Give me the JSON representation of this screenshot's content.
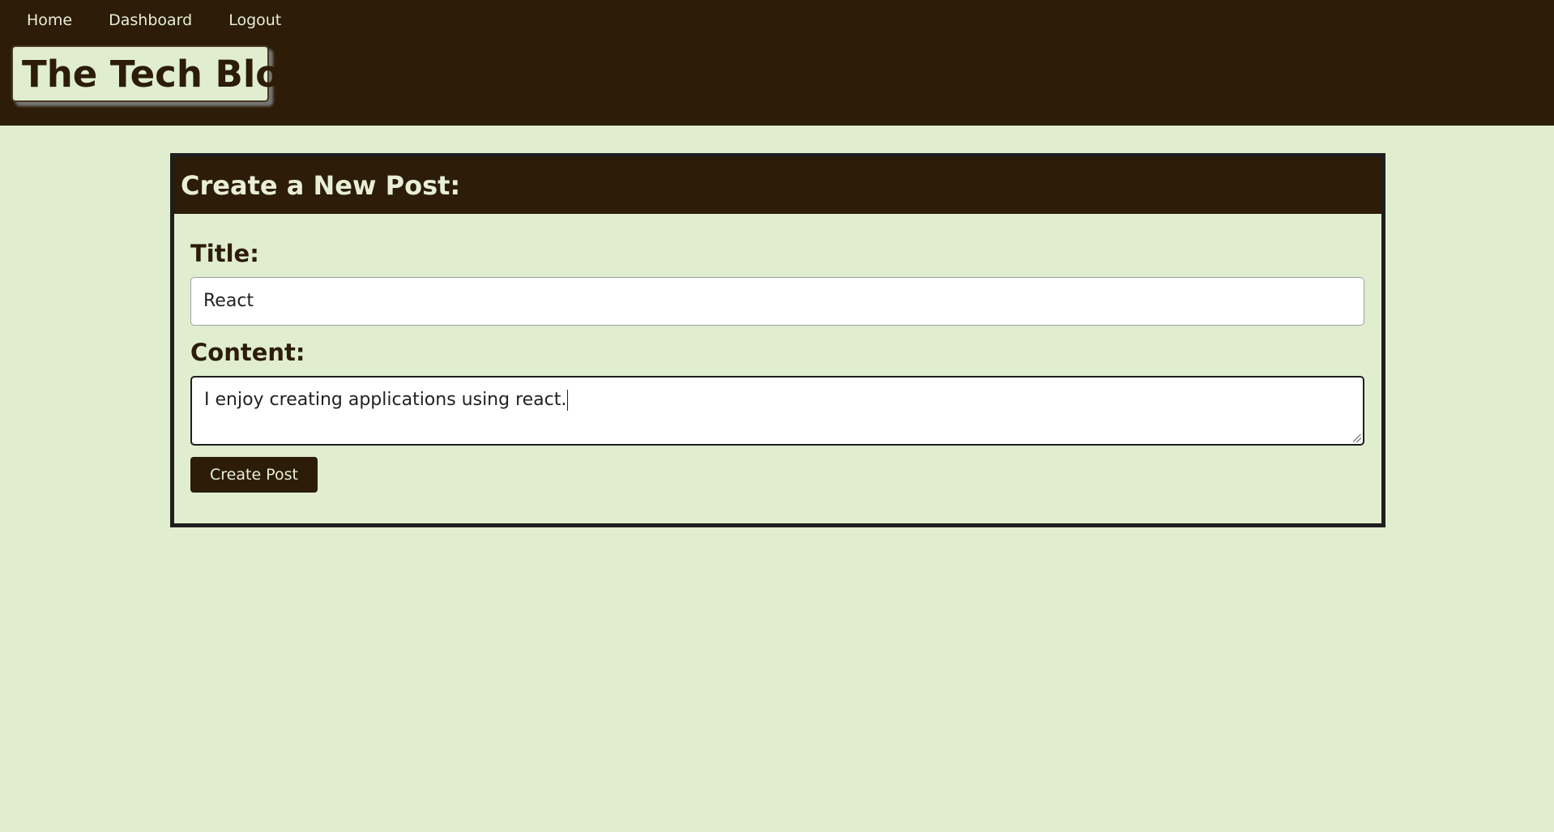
{
  "nav": {
    "items": [
      {
        "label": "Home"
      },
      {
        "label": "Dashboard"
      },
      {
        "label": "Logout"
      }
    ]
  },
  "brand": {
    "title": "The Tech Blog"
  },
  "form": {
    "heading": "Create a New Post:",
    "title_label": "Title:",
    "title_value": "React",
    "content_label": "Content:",
    "content_value": "I enjoy creating applications using react.",
    "submit_label": "Create Post"
  },
  "colors": {
    "header_bg": "#2c1c08",
    "page_bg": "#e0eecf",
    "nav_text": "#e8efd6",
    "card_border": "#1e1e1e"
  }
}
